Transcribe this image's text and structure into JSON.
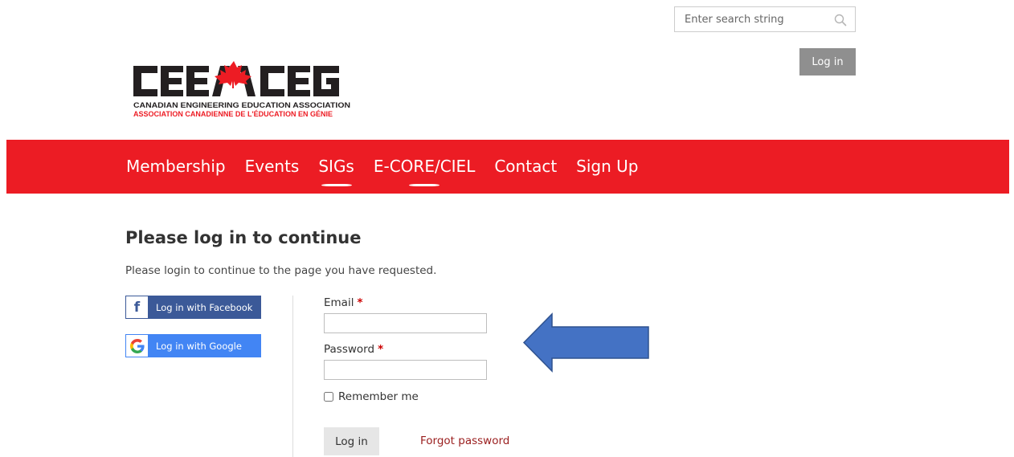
{
  "header": {
    "search_placeholder": "Enter search string",
    "login_label": "Log in"
  },
  "logo": {
    "wordmark": "CEEA ACEG",
    "line_en": "CANADIAN ENGINEERING EDUCATION ASSOCIATION",
    "line_fr": "ASSOCIATION CANADIENNE DE L'ÉDUCATION EN GÉNIE"
  },
  "nav": {
    "items": [
      {
        "label": "Membership",
        "active": false
      },
      {
        "label": "Events",
        "active": false
      },
      {
        "label": "SIGs",
        "active": true
      },
      {
        "label": "E-CORE/CIEL",
        "active": true
      },
      {
        "label": "Contact",
        "active": false
      },
      {
        "label": "Sign Up",
        "active": false
      }
    ]
  },
  "main": {
    "title": "Please log in to continue",
    "intro": "Please login to continue to the page you have requested.",
    "facebook_label": "Log in with Facebook",
    "google_label": "Log in with Google",
    "email_label": "Email",
    "password_label": "Password",
    "required_mark": "*",
    "remember_label": "Remember me",
    "submit_label": "Log in",
    "forgot_label": "Forgot password"
  },
  "colors": {
    "nav_bg": "#ec1c24",
    "brand_red": "#ed1c24",
    "facebook": "#3b5998",
    "google": "#4285f4",
    "annotation_arrow": "#4472c4",
    "forgot_link": "#9a1e1e"
  },
  "icons": {
    "search": "search-icon",
    "facebook": "facebook-icon",
    "google": "google-icon",
    "maple_leaf": "maple-leaf-icon",
    "annotation": "arrow-left-icon"
  }
}
